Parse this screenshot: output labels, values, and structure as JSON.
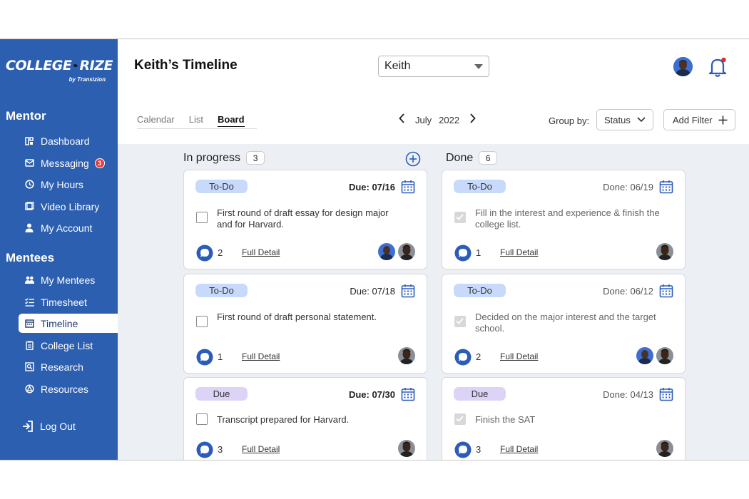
{
  "brand": {
    "name_left": "COLLEGE",
    "name_right": "RIZE",
    "subtitle": "by Transizion"
  },
  "sidebar": {
    "mentor_title": "Mentor",
    "mentor_items": [
      {
        "label": "Dashboard",
        "icon": "dashboard-icon"
      },
      {
        "label": "Messaging",
        "icon": "mail-icon",
        "badge": "3"
      },
      {
        "label": "My Hours",
        "icon": "clock-icon"
      },
      {
        "label": "Video Library",
        "icon": "video-icon"
      },
      {
        "label": "My Account",
        "icon": "user-icon"
      }
    ],
    "mentees_title": "Mentees",
    "mentees_items": [
      {
        "label": "My Mentees",
        "icon": "users-icon"
      },
      {
        "label": "Timesheet",
        "icon": "checklist-icon"
      },
      {
        "label": "Timeline",
        "icon": "calendar-icon",
        "active": true
      },
      {
        "label": "College List",
        "icon": "clipboard-icon"
      },
      {
        "label": "Research",
        "icon": "research-icon"
      },
      {
        "label": "Resources",
        "icon": "resources-icon"
      }
    ],
    "logout": "Log Out"
  },
  "header": {
    "title": "Keith’s Timeline",
    "mentee_select": "Keith"
  },
  "toolbar": {
    "tabs": [
      "Calendar",
      "List",
      "Board"
    ],
    "active_tab": "Board",
    "month": "July",
    "year": "2022",
    "group_by_label": "Group by:",
    "group_by_value": "Status",
    "add_filter": "Add Filter"
  },
  "colors": {
    "sidebar": "#2d5fb0",
    "accent": "#2b5cb8",
    "todo_tag": "#c7dafc",
    "due_tag": "#dcd3f7"
  },
  "columns": [
    {
      "title": "In progress",
      "count": "3",
      "cards": [
        {
          "tag": "To-Do",
          "date": "Due: 07/16",
          "text": "First round of draft essay for design major and for Harvard.",
          "comments": "2",
          "link": "Full Detail"
        },
        {
          "tag": "To-Do",
          "date": "Due: 07/18",
          "text": "First round of draft personal statement.",
          "comments": "1",
          "link": "Full Detail"
        },
        {
          "tag": "Due",
          "date": "Due: 07/30",
          "text": "Transcript prepared for Harvard.",
          "comments": "3",
          "link": "Full Detail"
        }
      ]
    },
    {
      "title": "Done",
      "count": "6",
      "cards": [
        {
          "tag": "To-Do",
          "date": "Done: 06/19",
          "text": "Fill in the interest and experience & finish the college list.",
          "comments": "1",
          "link": "Full Detail"
        },
        {
          "tag": "To-Do",
          "date": "Done: 06/12",
          "text": "Decided on the major interest and the target school.",
          "comments": "2",
          "link": "Full Detail"
        },
        {
          "tag": "Due",
          "date": "Done: 04/13",
          "text": "Finish the SAT",
          "comments": "3",
          "link": "Full Detail"
        }
      ]
    }
  ]
}
